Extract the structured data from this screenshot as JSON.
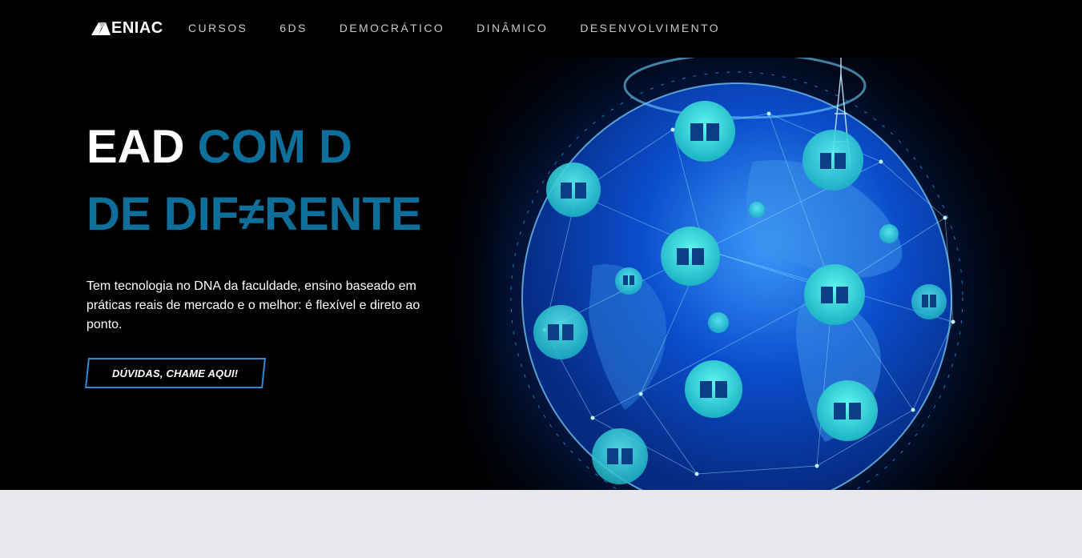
{
  "header": {
    "logo_text": "ENIAC",
    "nav": [
      {
        "label": "CURSOS"
      },
      {
        "label": "6DS"
      },
      {
        "label": "DEMOCRÁTICO"
      },
      {
        "label": "DINÂMICO"
      },
      {
        "label": "DESENVOLVIMENTO"
      }
    ]
  },
  "hero": {
    "headline_white": "EAD",
    "headline_blue": "COM D",
    "headline_line2": "DE DIF≠RENTE",
    "description": "Tem tecnologia no DNA da faculdade, ensino baseado em práticas reais de mercado e o melhor: é flexível e direto ao ponto.",
    "cta_label": "DÚVIDAS, CHAME AQUI!",
    "image_icon": "globe-with-books-icon"
  },
  "colors": {
    "accent_blue": "#0e6f9b",
    "button_border": "#2d8bd6",
    "background": "#000000",
    "lower_section": "#e9e8ec"
  }
}
